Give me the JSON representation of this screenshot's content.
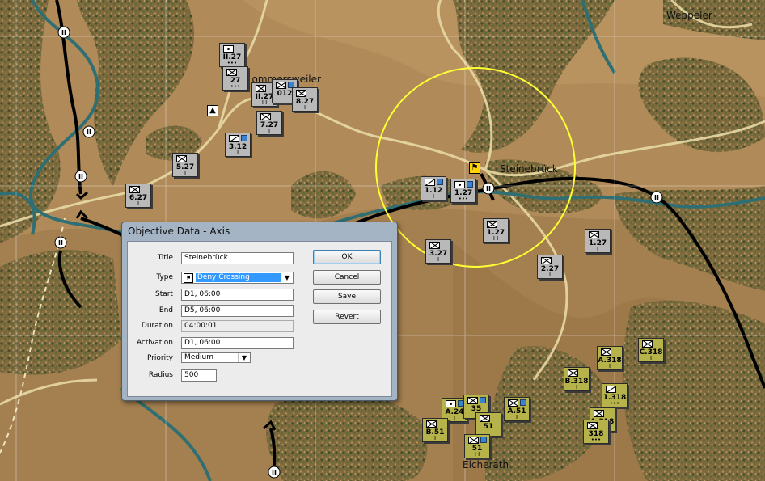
{
  "map": {
    "places": [
      {
        "name": "Weppeler"
      },
      {
        "name": "Steinebrück"
      },
      {
        "name": "Elcherath"
      },
      {
        "name": "Lommersweiler"
      }
    ],
    "units": [
      {
        "label": "II.27",
        "style": "grey",
        "sym": "arty",
        "size": "•••",
        "sq": false
      },
      {
        "label": "27",
        "style": "grey",
        "sym": "inf",
        "size": "•••",
        "sq": false
      },
      {
        "label": "II.27",
        "style": "grey",
        "sym": "inf",
        "size": "I I",
        "sq": false
      },
      {
        "label": "012",
        "style": "grey",
        "sym": "inf",
        "size": "",
        "sq": true
      },
      {
        "label": "8.27",
        "style": "grey",
        "sym": "inf",
        "size": "I",
        "sq": false
      },
      {
        "label": "7.27",
        "style": "grey",
        "sym": "inf",
        "size": "I",
        "sq": false
      },
      {
        "label": "3.12",
        "style": "grey",
        "sym": "recon",
        "size": "I",
        "sq": true
      },
      {
        "label": "5.27",
        "style": "grey",
        "sym": "inf",
        "size": "I",
        "sq": false
      },
      {
        "label": "6.27",
        "style": "grey",
        "sym": "inf",
        "size": "I",
        "sq": false
      },
      {
        "label": "1.12",
        "style": "grey",
        "sym": "recon",
        "size": "I",
        "sq": true
      },
      {
        "label": "1.27",
        "style": "grey",
        "sym": "arty",
        "size": "•••",
        "sq": true
      },
      {
        "label": "1.27",
        "style": "grey",
        "sym": "inf",
        "size": "I I",
        "sq": false
      },
      {
        "label": "3.27",
        "style": "grey",
        "sym": "inf",
        "size": "I",
        "sq": false
      },
      {
        "label": "2.27",
        "style": "grey",
        "sym": "inf",
        "size": "I",
        "sq": false
      },
      {
        "label": "1.27",
        "style": "grey",
        "sym": "inf",
        "size": "I",
        "sq": false
      },
      {
        "label": "A.318",
        "style": "olive",
        "sym": "inf",
        "size": "I",
        "sq": false
      },
      {
        "label": "C.318",
        "style": "olive",
        "sym": "inf",
        "size": "I",
        "sq": false
      },
      {
        "label": "B.318",
        "style": "olive",
        "sym": "inf",
        "size": "I",
        "sq": false
      },
      {
        "label": "1.318",
        "style": "olive",
        "sym": "recon",
        "size": "•••",
        "sq": false
      },
      {
        "label": "1.318",
        "style": "olive",
        "sym": "inf",
        "size": "•••",
        "sq": false
      },
      {
        "label": "318",
        "style": "olive",
        "sym": "inf",
        "size": "•••",
        "sq": false
      },
      {
        "label": "A.24",
        "style": "olive",
        "sym": "arty",
        "size": "I",
        "sq": true
      },
      {
        "label": "35",
        "style": "olive",
        "sym": "inf",
        "size": "",
        "sq": true
      },
      {
        "label": "A.51",
        "style": "olive",
        "sym": "inf",
        "size": "I",
        "sq": true
      },
      {
        "label": "51",
        "style": "olive",
        "sym": "inf",
        "size": "",
        "sq": false
      },
      {
        "label": "B.51",
        "style": "olive",
        "sym": "inf",
        "size": "I",
        "sq": false
      },
      {
        "label": "51",
        "style": "olive",
        "sym": "inf",
        "size": "I I",
        "sq": true
      }
    ],
    "crossings": [
      "II",
      "II",
      "II",
      "II",
      "II",
      "II",
      "II"
    ],
    "objective_icon": "objective-flag-icon",
    "cover_icon": "cover-icon"
  },
  "dialog": {
    "title": "Objective Data - Axis",
    "fields": {
      "title_label": "Title",
      "title_value": "Steinebrück",
      "type_label": "Type",
      "type_value": "Deny Crossing",
      "start_label": "Start",
      "start_value": "D1, 06:00",
      "end_label": "End",
      "end_value": "D5, 06:00",
      "duration_label": "Duration",
      "duration_value": "04:00:01",
      "activation_label": "Activation",
      "activation_value": "D1, 06:00",
      "priority_label": "Priority",
      "priority_value": "Medium",
      "radius_label": "Radius",
      "radius_value": "500"
    },
    "buttons": {
      "ok": "OK",
      "cancel": "Cancel",
      "save": "Save",
      "revert": "Revert"
    },
    "colors": {
      "frame": "#a4b4c5",
      "selection": "#3399ff"
    }
  },
  "colors": {
    "terrain": "#b08a58",
    "river": "#2f6f73",
    "rail": "#000000",
    "objective_circle": "#ffff33"
  }
}
